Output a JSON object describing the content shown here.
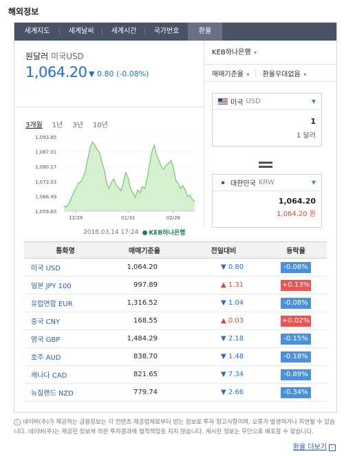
{
  "section_title": "해외정보",
  "tabs": [
    {
      "label": "세계지도",
      "active": false
    },
    {
      "label": "세계날씨",
      "active": false
    },
    {
      "label": "세계시간",
      "active": false
    },
    {
      "label": "국가번호",
      "active": false
    },
    {
      "label": "환율",
      "active": true
    }
  ],
  "currency": {
    "name": "원달러",
    "code_label": "미국USD",
    "rate": "1,064.20",
    "change": "▼ 0.80 (-0.08%)"
  },
  "periods": [
    {
      "label": "3개월",
      "active": true
    },
    {
      "label": "1년",
      "active": false
    },
    {
      "label": "3년",
      "active": false
    },
    {
      "label": "10년",
      "active": false
    }
  ],
  "chart_data": {
    "type": "area",
    "y_ticks": [
      "1,093.85",
      "1,087.01",
      "1,080.17",
      "1,073.33",
      "1,066.49",
      "1,059.65"
    ],
    "ylim": [
      1059.65,
      1093.85
    ],
    "x_ticks": [
      {
        "label": "12/29",
        "at": 5
      },
      {
        "label": "01/31",
        "at": 27
      },
      {
        "label": "02/28",
        "at": 46
      }
    ],
    "values": [
      1062.0,
      1061.5,
      1063.0,
      1065.5,
      1068.0,
      1070.0,
      1072.5,
      1073.0,
      1075.0,
      1078.0,
      1083.5,
      1089.0,
      1091.5,
      1090.0,
      1088.0,
      1086.5,
      1082.0,
      1078.5,
      1072.5,
      1070.0,
      1073.0,
      1074.5,
      1071.5,
      1070.5,
      1069.0,
      1073.0,
      1077.5,
      1075.0,
      1070.0,
      1068.0,
      1066.0,
      1069.5,
      1068.0,
      1071.0,
      1070.0,
      1075.0,
      1081.0,
      1087.0,
      1090.0,
      1085.5,
      1083.0,
      1080.0,
      1079.0,
      1081.0,
      1081.5,
      1083.0,
      1080.0,
      1074.0,
      1072.5,
      1070.0,
      1071.5,
      1069.5,
      1066.5,
      1067.0,
      1065.0,
      1064.2
    ],
    "timestamp": "2018.03.14 17:24",
    "source": "KEB하나은행"
  },
  "right": {
    "bank": "KEB하나은행",
    "rate_type": "매매기준율",
    "discount": "환율우대없음",
    "from": {
      "country": "미국",
      "code": "USD",
      "amount": "1",
      "unit": "1 달러"
    },
    "to": {
      "country": "대한민국",
      "code": "KRW",
      "amount": "1,064.20",
      "unit": "1,064.20 원"
    }
  },
  "table": {
    "headers": [
      "통화명",
      "매매기준율",
      "전일대비",
      "등락율"
    ],
    "rows": [
      {
        "name": "미국 USD",
        "rate": "1,064.20",
        "dir": "down",
        "change": "▼ 0.80",
        "pct": "-0.08%"
      },
      {
        "name": "일본 JPY 100",
        "rate": "997.89",
        "dir": "up",
        "change": "▲ 1.31",
        "pct": "+0.13%"
      },
      {
        "name": "유럽연합 EUR",
        "rate": "1,316.52",
        "dir": "down",
        "change": "▼ 1.04",
        "pct": "-0.08%"
      },
      {
        "name": "중국 CNY",
        "rate": "168.55",
        "dir": "up",
        "change": "▲ 0.03",
        "pct": "+0.02%"
      },
      {
        "name": "영국 GBP",
        "rate": "1,484.29",
        "dir": "down",
        "change": "▼ 2.18",
        "pct": "-0.15%"
      },
      {
        "name": "호주 AUD",
        "rate": "838.70",
        "dir": "down",
        "change": "▼ 1.48",
        "pct": "-0.18%"
      },
      {
        "name": "캐나다 CAD",
        "rate": "821.65",
        "dir": "down",
        "change": "▼ 7.34",
        "pct": "-0.89%"
      },
      {
        "name": "뉴질랜드 NZD",
        "rate": "779.74",
        "dir": "down",
        "change": "▼ 2.66",
        "pct": "-0.34%"
      }
    ]
  },
  "notice": "네이버(주)가 제공하는 금융정보는 각 컨텐츠 제공업체로부터 받는 정보로 투자 참고사항이며, 오류가 발생하거나 지연될 수 있습니다. 네이버(주)는 제공된 정보에 의한 투자결과에 법적책임을 지지 않습니다. 게시된 정보는 무단으로 배포할 수 없습니다.",
  "more_link": "환율 더보기",
  "colors": {
    "accent_blue": "#1f6fd1",
    "up_red": "#d94a2c",
    "chart_green": "#72c96e",
    "tab_bg": "#4a5266"
  }
}
